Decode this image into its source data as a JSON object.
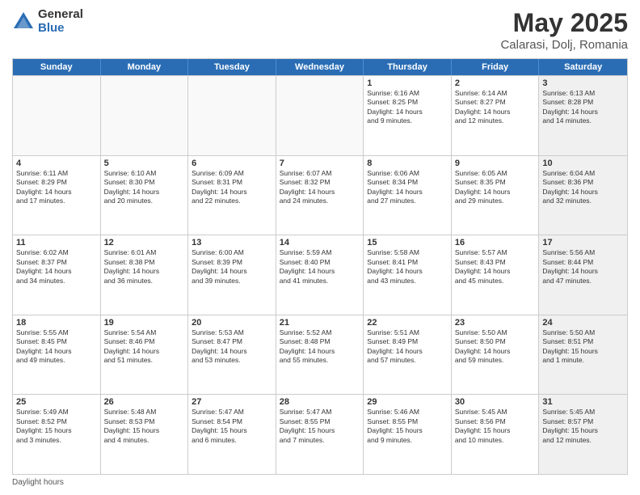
{
  "logo": {
    "general": "General",
    "blue": "Blue"
  },
  "title": "May 2025",
  "location": "Calarasi, Dolj, Romania",
  "days_of_week": [
    "Sunday",
    "Monday",
    "Tuesday",
    "Wednesday",
    "Thursday",
    "Friday",
    "Saturday"
  ],
  "footer": "Daylight hours",
  "weeks": [
    [
      {
        "day": "",
        "content": "",
        "empty": true
      },
      {
        "day": "",
        "content": "",
        "empty": true
      },
      {
        "day": "",
        "content": "",
        "empty": true
      },
      {
        "day": "",
        "content": "",
        "empty": true
      },
      {
        "day": "1",
        "content": "Sunrise: 6:16 AM\nSunset: 8:25 PM\nDaylight: 14 hours\nand 9 minutes."
      },
      {
        "day": "2",
        "content": "Sunrise: 6:14 AM\nSunset: 8:27 PM\nDaylight: 14 hours\nand 12 minutes."
      },
      {
        "day": "3",
        "content": "Sunrise: 6:13 AM\nSunset: 8:28 PM\nDaylight: 14 hours\nand 14 minutes.",
        "shaded": true
      }
    ],
    [
      {
        "day": "4",
        "content": "Sunrise: 6:11 AM\nSunset: 8:29 PM\nDaylight: 14 hours\nand 17 minutes."
      },
      {
        "day": "5",
        "content": "Sunrise: 6:10 AM\nSunset: 8:30 PM\nDaylight: 14 hours\nand 20 minutes."
      },
      {
        "day": "6",
        "content": "Sunrise: 6:09 AM\nSunset: 8:31 PM\nDaylight: 14 hours\nand 22 minutes."
      },
      {
        "day": "7",
        "content": "Sunrise: 6:07 AM\nSunset: 8:32 PM\nDaylight: 14 hours\nand 24 minutes."
      },
      {
        "day": "8",
        "content": "Sunrise: 6:06 AM\nSunset: 8:34 PM\nDaylight: 14 hours\nand 27 minutes."
      },
      {
        "day": "9",
        "content": "Sunrise: 6:05 AM\nSunset: 8:35 PM\nDaylight: 14 hours\nand 29 minutes."
      },
      {
        "day": "10",
        "content": "Sunrise: 6:04 AM\nSunset: 8:36 PM\nDaylight: 14 hours\nand 32 minutes.",
        "shaded": true
      }
    ],
    [
      {
        "day": "11",
        "content": "Sunrise: 6:02 AM\nSunset: 8:37 PM\nDaylight: 14 hours\nand 34 minutes."
      },
      {
        "day": "12",
        "content": "Sunrise: 6:01 AM\nSunset: 8:38 PM\nDaylight: 14 hours\nand 36 minutes."
      },
      {
        "day": "13",
        "content": "Sunrise: 6:00 AM\nSunset: 8:39 PM\nDaylight: 14 hours\nand 39 minutes."
      },
      {
        "day": "14",
        "content": "Sunrise: 5:59 AM\nSunset: 8:40 PM\nDaylight: 14 hours\nand 41 minutes."
      },
      {
        "day": "15",
        "content": "Sunrise: 5:58 AM\nSunset: 8:41 PM\nDaylight: 14 hours\nand 43 minutes."
      },
      {
        "day": "16",
        "content": "Sunrise: 5:57 AM\nSunset: 8:43 PM\nDaylight: 14 hours\nand 45 minutes."
      },
      {
        "day": "17",
        "content": "Sunrise: 5:56 AM\nSunset: 8:44 PM\nDaylight: 14 hours\nand 47 minutes.",
        "shaded": true
      }
    ],
    [
      {
        "day": "18",
        "content": "Sunrise: 5:55 AM\nSunset: 8:45 PM\nDaylight: 14 hours\nand 49 minutes."
      },
      {
        "day": "19",
        "content": "Sunrise: 5:54 AM\nSunset: 8:46 PM\nDaylight: 14 hours\nand 51 minutes."
      },
      {
        "day": "20",
        "content": "Sunrise: 5:53 AM\nSunset: 8:47 PM\nDaylight: 14 hours\nand 53 minutes."
      },
      {
        "day": "21",
        "content": "Sunrise: 5:52 AM\nSunset: 8:48 PM\nDaylight: 14 hours\nand 55 minutes."
      },
      {
        "day": "22",
        "content": "Sunrise: 5:51 AM\nSunset: 8:49 PM\nDaylight: 14 hours\nand 57 minutes."
      },
      {
        "day": "23",
        "content": "Sunrise: 5:50 AM\nSunset: 8:50 PM\nDaylight: 14 hours\nand 59 minutes."
      },
      {
        "day": "24",
        "content": "Sunrise: 5:50 AM\nSunset: 8:51 PM\nDaylight: 15 hours\nand 1 minute.",
        "shaded": true
      }
    ],
    [
      {
        "day": "25",
        "content": "Sunrise: 5:49 AM\nSunset: 8:52 PM\nDaylight: 15 hours\nand 3 minutes."
      },
      {
        "day": "26",
        "content": "Sunrise: 5:48 AM\nSunset: 8:53 PM\nDaylight: 15 hours\nand 4 minutes."
      },
      {
        "day": "27",
        "content": "Sunrise: 5:47 AM\nSunset: 8:54 PM\nDaylight: 15 hours\nand 6 minutes."
      },
      {
        "day": "28",
        "content": "Sunrise: 5:47 AM\nSunset: 8:55 PM\nDaylight: 15 hours\nand 7 minutes."
      },
      {
        "day": "29",
        "content": "Sunrise: 5:46 AM\nSunset: 8:55 PM\nDaylight: 15 hours\nand 9 minutes."
      },
      {
        "day": "30",
        "content": "Sunrise: 5:45 AM\nSunset: 8:56 PM\nDaylight: 15 hours\nand 10 minutes."
      },
      {
        "day": "31",
        "content": "Sunrise: 5:45 AM\nSunset: 8:57 PM\nDaylight: 15 hours\nand 12 minutes.",
        "shaded": true
      }
    ]
  ]
}
